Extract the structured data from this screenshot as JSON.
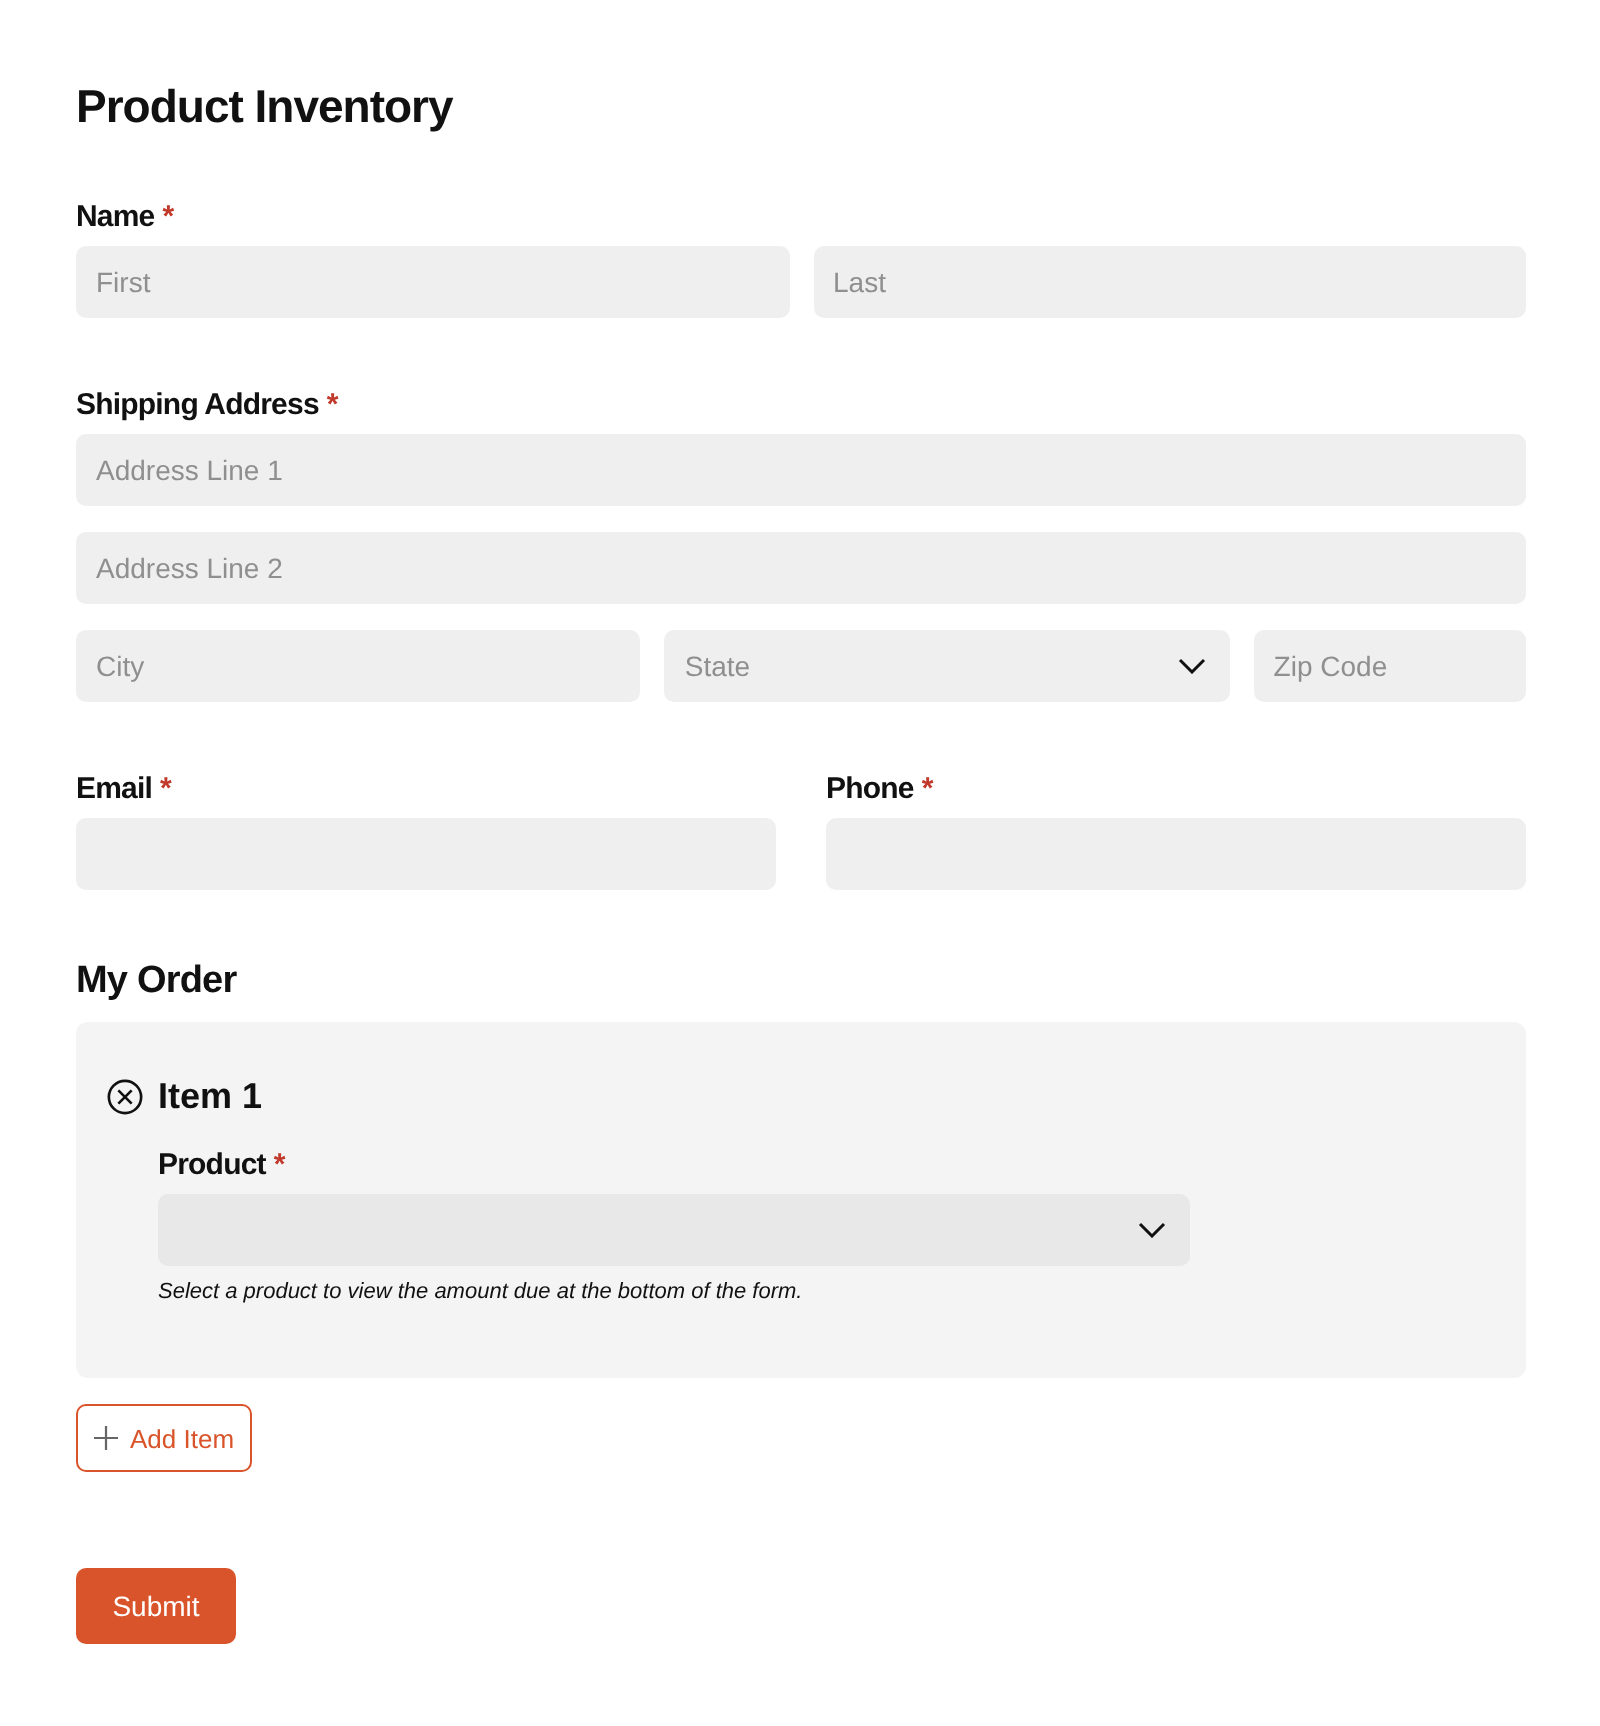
{
  "title": "Product Inventory",
  "rows": [
    {
      "groups": [
        {
          "label": "Name",
          "required_mark": "*",
          "lines": [
            [
              {
                "kind": "text",
                "placeholder": "First"
              },
              {
                "kind": "text",
                "placeholder": "Last"
              }
            ]
          ]
        }
      ]
    },
    {
      "groups": [
        {
          "label": "Shipping Address",
          "required_mark": "*",
          "lines": [
            [
              {
                "kind": "text",
                "placeholder": "Address Line 1"
              }
            ],
            [
              {
                "kind": "text",
                "placeholder": "Address Line 2"
              }
            ],
            [
              {
                "kind": "text",
                "placeholder": "City"
              },
              {
                "kind": "select",
                "placeholder": "State"
              },
              {
                "kind": "text",
                "placeholder": "Zip Code"
              }
            ]
          ]
        }
      ]
    },
    {
      "groups": [
        {
          "label": "Email",
          "required_mark": "*",
          "lines": [
            [
              {
                "kind": "text"
              }
            ]
          ]
        },
        {
          "label": "Phone",
          "required_mark": "*",
          "lines": [
            [
              {
                "kind": "text"
              }
            ]
          ]
        }
      ]
    }
  ],
  "order": {
    "heading": "My Order",
    "items": [
      {
        "title": "Item 1",
        "field": {
          "label": "Product",
          "required_mark": "*",
          "kind": "select"
        },
        "hint": "Select a product to view the amount due at the bottom of the form."
      }
    ],
    "add_button": "Add Item"
  },
  "submit_button": "Submit"
}
